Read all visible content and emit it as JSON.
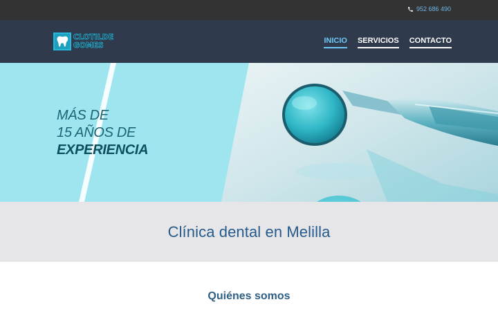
{
  "topbar": {
    "phone": "952 686 490",
    "phone_icon": "phone-icon"
  },
  "header": {
    "logo_line1": "CLOTILDE",
    "logo_line2": "GOMES",
    "logo_icon": "tooth-icon",
    "nav": [
      {
        "label": "INICIO",
        "active": true
      },
      {
        "label": "SERVICIOS",
        "active": false
      },
      {
        "label": "CONTACTO",
        "active": false
      }
    ]
  },
  "hero": {
    "line1": "MÁS DE",
    "line2": "15 AÑOS DE",
    "line3": "EXPERIENCIA"
  },
  "band": {
    "title": "Clínica dental en Melilla"
  },
  "about": {
    "title": "Quiénes somos"
  },
  "colors": {
    "accent": "#6fc9f5",
    "header_bg": "#2f3a4d",
    "topbar_bg": "#333333",
    "hero_bg": "#9ee5ef",
    "title": "#245a8c"
  }
}
